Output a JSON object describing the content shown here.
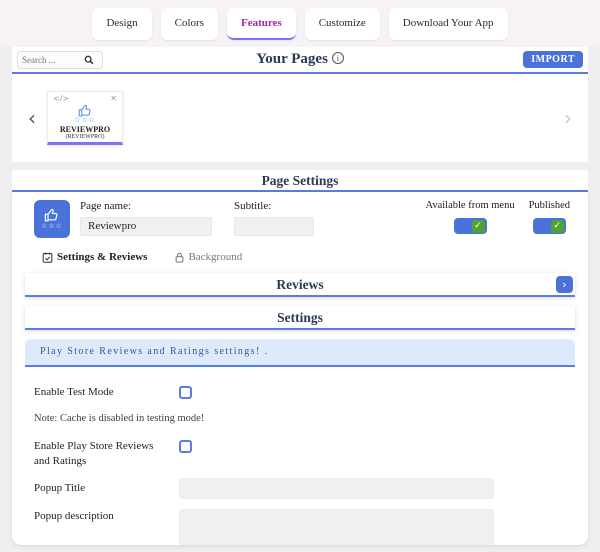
{
  "topnav": {
    "tabs": [
      {
        "label": "Design",
        "active": false
      },
      {
        "label": "Colors",
        "active": false
      },
      {
        "label": "Features",
        "active": true
      },
      {
        "label": "Customize",
        "active": false
      },
      {
        "label": "Download Your App",
        "active": false
      }
    ]
  },
  "your_pages": {
    "title": "Your Pages",
    "search_placeholder": "Search ...",
    "import_label": "IMPORT"
  },
  "carousel": {
    "card_title": "REVIEWPRO",
    "card_subtitle": "(REVIEWPRO)"
  },
  "page_settings": {
    "title": "Page Settings",
    "page_name_label": "Page name:",
    "page_name_value": "Reviewpro",
    "subtitle_label": "Subtitle:",
    "subtitle_value": "",
    "available_from_menu_label": "Available from menu",
    "available_from_menu_on": true,
    "published_label": "Published",
    "published_on": true,
    "subtabs": [
      {
        "label": "Settings & Reviews",
        "active": true
      },
      {
        "label": "Background",
        "active": false
      }
    ]
  },
  "sections": {
    "reviews_title": "Reviews",
    "settings_title": "Settings",
    "info_banner": "Play Store Reviews and Ratings settings! ."
  },
  "form": {
    "enable_test_mode_label": "Enable Test Mode",
    "test_mode_checked": false,
    "note": "Note: Cache is disabled in testing mode!",
    "enable_reviews_label": "Enable Play Store Reviews and Ratings",
    "enable_reviews_checked": false,
    "popup_title_label": "Popup Title",
    "popup_title_value": "",
    "popup_description_label": "Popup description",
    "popup_description_value": ""
  },
  "icons": {
    "check": "✓",
    "chevron_left": "‹",
    "chevron_right": "›",
    "close": "✕",
    "code": "</>",
    "info": "i",
    "stars": "☆☆☆",
    "expand": "›"
  },
  "colors": {
    "accent_blue": "#4a72d8",
    "underline_blue": "#5b7ce0",
    "active_tab_purple": "#a820b4",
    "tab_underline_purple": "#7b74f2",
    "toggle_check_green": "#56a033",
    "info_banner_bg": "#dceafb",
    "heading_navy": "#2c3a56"
  }
}
